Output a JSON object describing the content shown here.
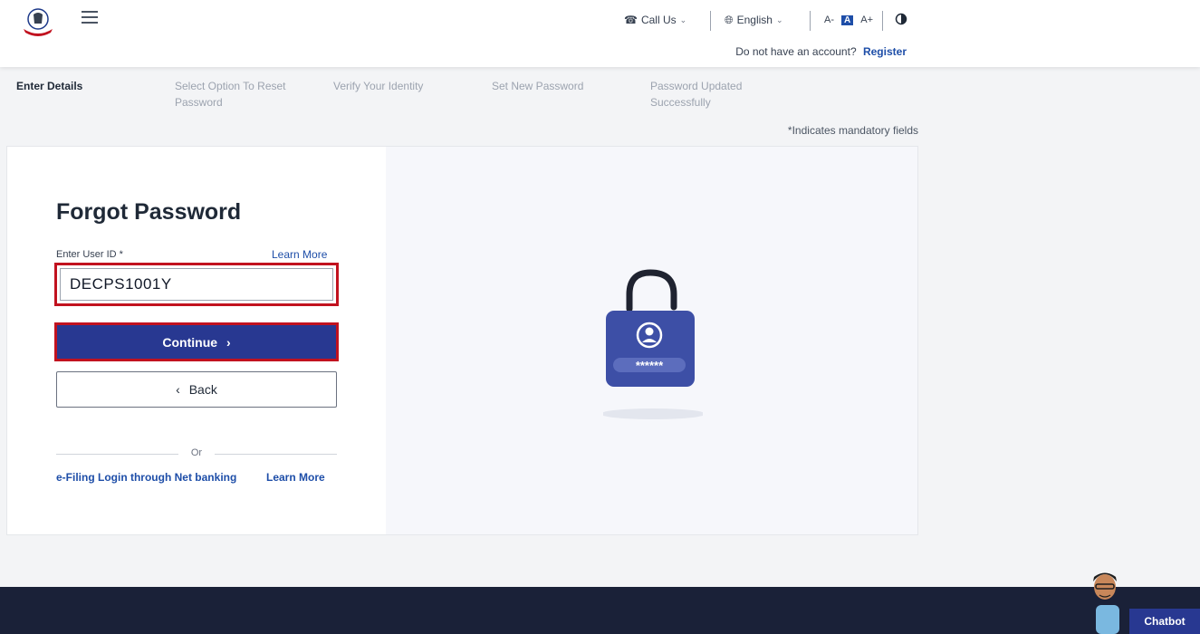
{
  "header": {
    "call_us": "Call Us",
    "language": "English",
    "font_small": "A-",
    "font_normal": "A",
    "font_large": "A+",
    "account_prompt": "Do not have an account?",
    "register_label": "Register"
  },
  "steps": [
    {
      "label": "Enter Details",
      "active": true
    },
    {
      "label": "Select Option To Reset Password",
      "active": false
    },
    {
      "label": "Verify Your Identity",
      "active": false
    },
    {
      "label": "Set New Password",
      "active": false
    },
    {
      "label": "Password Updated Successfully",
      "active": false
    }
  ],
  "mandatory_note": "*Indicates mandatory fields",
  "form": {
    "title": "Forgot Password",
    "user_id_label": "Enter User ID *",
    "learn_more": "Learn More",
    "user_id_value": "DECPS1001Y",
    "continue_label": "Continue",
    "back_label": "Back",
    "or_label": "Or",
    "netbanking_label": "e-Filing Login through Net banking",
    "netbanking_learn_more": "Learn More"
  },
  "illustration": {
    "masked_password": "******"
  },
  "chatbot_label": "Chatbot",
  "colors": {
    "primary": "#283891",
    "highlight": "#c1121f",
    "link": "#1e4ea8",
    "footer": "#1a2138"
  }
}
